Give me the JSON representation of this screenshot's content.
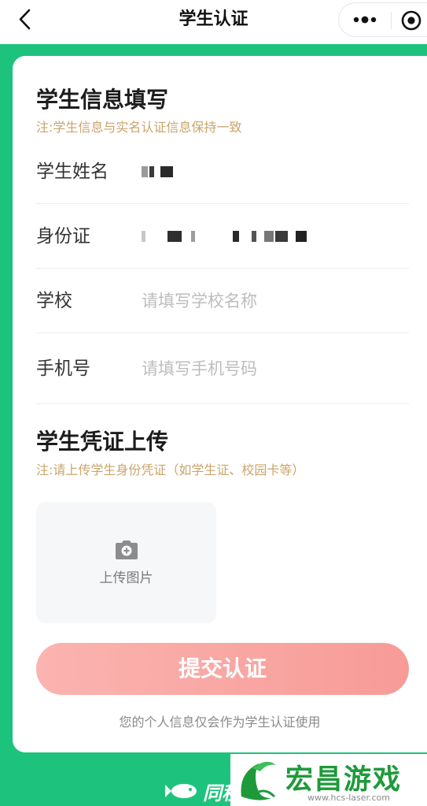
{
  "nav": {
    "title": "学生认证",
    "back_icon": "chevron-left-icon",
    "more_icon": "more-dots-icon",
    "close_icon": "target-close-icon"
  },
  "section_info": {
    "title": "学生信息填写",
    "note": "注:学生信息与实名认证信息保持一致"
  },
  "fields": [
    {
      "label": "学生姓名",
      "value": "",
      "placeholder": ""
    },
    {
      "label": "身份证",
      "value": "",
      "placeholder": ""
    },
    {
      "label": "学校",
      "value": "",
      "placeholder": "请填写学校名称"
    },
    {
      "label": "手机号",
      "value": "",
      "placeholder": "请填写手机号码"
    }
  ],
  "section_upload": {
    "title": "学生凭证上传",
    "note": "注:请上传学生身份凭证（如学生证、校园卡等）",
    "upload_label": "上传图片",
    "upload_icon": "camera-add-icon"
  },
  "submit": {
    "label": "提交认证"
  },
  "footnote": "您的个人信息仅会作为学生认证使用",
  "brand": {
    "text": "同程",
    "icon": "fish-logo-icon"
  },
  "watermark": {
    "name": "宏昌游戏网",
    "url": "www.hcs-laser.com",
    "icon": "wave-logo-icon"
  },
  "colors": {
    "accent_green": "#1dc37c",
    "note_gold": "#caa46a",
    "button_pink": "#f79b97"
  }
}
